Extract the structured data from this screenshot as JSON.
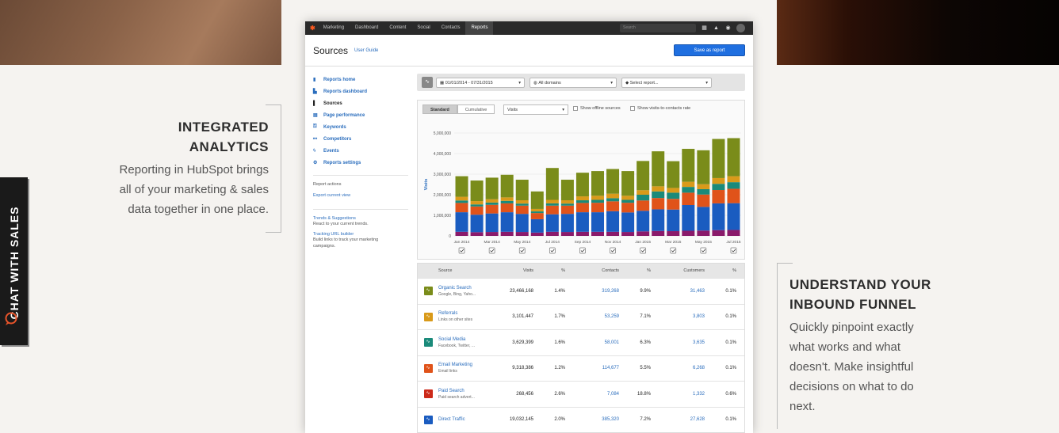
{
  "chat": {
    "label": "CHAT WITH SALES"
  },
  "feature_left": {
    "title_line1": "INTEGRATED",
    "title_line2": "ANALYTICS",
    "body_line1": "Reporting in HubSpot brings",
    "body_line2": "all of your marketing & sales",
    "body_line3": "data together in one place."
  },
  "feature_right": {
    "title_line1": "UNDERSTAND YOUR",
    "title_line2": "INBOUND FUNNEL",
    "body_line1": "Quickly pinpoint exactly",
    "body_line2": "what works and what",
    "body_line3": "doesn't. Make insightful",
    "body_line4": "decisions on what to do",
    "body_line5": "next."
  },
  "app": {
    "nav": {
      "brand": "Marketing",
      "items": [
        "Dashboard",
        "Content",
        "Social",
        "Contacts",
        "Reports"
      ],
      "active": "Reports",
      "search_placeholder": "Search"
    },
    "page_title": "Sources",
    "user_guide": "User Guide",
    "save_button": "Save as report",
    "sidebar": {
      "items": [
        {
          "label": "Reports home",
          "icon": "bar-chart-icon"
        },
        {
          "label": "Reports dashboard",
          "icon": "dashboard-icon"
        },
        {
          "label": "Sources",
          "icon": "bars-icon"
        },
        {
          "label": "Page performance",
          "icon": "page-icon"
        },
        {
          "label": "Keywords",
          "icon": "key-icon"
        },
        {
          "label": "Competitors",
          "icon": "competitors-icon"
        },
        {
          "label": "Events",
          "icon": "bolt-icon"
        },
        {
          "label": "Reports settings",
          "icon": "gear-icon"
        }
      ],
      "actions_title": "Report actions",
      "export_link": "Export current view",
      "trends_link": "Trends & Suggestions",
      "trends_desc": "React to your current trends.",
      "tracking_link": "Tracking URL builder",
      "tracking_desc_1": "Build links to track your marketing",
      "tracking_desc_2": "campaigns."
    },
    "filters": {
      "date_range": "01/01/2014 - 07/31/2015",
      "domains": "All domains",
      "report": "Select report..."
    },
    "chart_controls": {
      "tab_standard": "Standard",
      "tab_cumulative": "Cumulative",
      "metric": "Visits",
      "offline_label": "Show offline sources",
      "rate_label": "Show visits-to-contacts rate"
    }
  },
  "chart_data": {
    "type": "bar",
    "stacked": true,
    "ylabel": "Visits",
    "ylim": [
      0,
      5000000
    ],
    "yticks": [
      "0",
      "1,000,000",
      "2,000,000",
      "3,000,000",
      "4,000,000",
      "5,000,000"
    ],
    "categories": [
      "Jan 2014",
      "Feb 2014",
      "Mar 2014",
      "Apr 2014",
      "May 2014",
      "Jun 2014",
      "Jul 2014",
      "Aug 2014",
      "Sep 2014",
      "Oct 2014",
      "Nov 2014",
      "Dec 2014",
      "Jan 2015",
      "Feb 2015",
      "Mar 2015",
      "Apr 2015",
      "May 2015",
      "Jun 2015",
      "Jul 2015"
    ],
    "xtick_labels": [
      "Jan 2014",
      "Mar 2014",
      "May 2014",
      "Jul 2014",
      "Sep 2014",
      "Nov 2014",
      "Jan 2015",
      "Mar 2015",
      "May 2015",
      "Jul 2015"
    ],
    "series": [
      {
        "color": "#8a1a6b",
        "values": [
          200000,
          180000,
          190000,
          200000,
          190000,
          160000,
          200000,
          190000,
          200000,
          200000,
          200000,
          190000,
          220000,
          240000,
          230000,
          250000,
          260000,
          280000,
          290000
        ]
      },
      {
        "color": "#1a5cc0",
        "values": [
          950000,
          850000,
          900000,
          950000,
          880000,
          650000,
          850000,
          880000,
          950000,
          950000,
          1000000,
          950000,
          1000000,
          1050000,
          1050000,
          1250000,
          1150000,
          1300000,
          1300000
        ]
      },
      {
        "color": "#e0531a",
        "values": [
          450000,
          400000,
          420000,
          430000,
          400000,
          300000,
          420000,
          400000,
          450000,
          460000,
          480000,
          470000,
          500000,
          550000,
          520000,
          600000,
          600000,
          650000,
          700000
        ]
      },
      {
        "color": "#1a8a7a",
        "values": [
          120000,
          100000,
          110000,
          120000,
          100000,
          80000,
          110000,
          100000,
          130000,
          140000,
          150000,
          140000,
          280000,
          320000,
          300000,
          280000,
          260000,
          300000,
          320000
        ]
      },
      {
        "color": "#d99a1a",
        "values": [
          180000,
          160000,
          160000,
          170000,
          160000,
          120000,
          170000,
          160000,
          190000,
          200000,
          220000,
          200000,
          220000,
          250000,
          230000,
          250000,
          240000,
          280000,
          290000
        ]
      },
      {
        "color": "#7a8c1a",
        "values": [
          1000000,
          1000000,
          1050000,
          1100000,
          1000000,
          850000,
          1550000,
          1000000,
          1150000,
          1200000,
          1200000,
          1200000,
          1420000,
          1700000,
          1300000,
          1600000,
          1650000,
          1900000,
          1850000
        ]
      }
    ]
  },
  "table": {
    "headers": {
      "source": "Source",
      "visits": "Visits",
      "pct1": "%",
      "contacts": "Contacts",
      "pct2": "%",
      "customers": "Customers",
      "pct3": "%"
    },
    "rows": [
      {
        "name": "Organic Search",
        "sub": "Google, Bing, Yaho...",
        "color": "#7a8c1a",
        "visits": "23,466,168",
        "pct1": "1.4%",
        "contacts": "319,268",
        "pct2": "9.9%",
        "customers": "31,463",
        "pct3": "0.1%"
      },
      {
        "name": "Referrals",
        "sub": "Links on other sites",
        "color": "#d99a1a",
        "visits": "3,101,447",
        "pct1": "1.7%",
        "contacts": "53,259",
        "pct2": "7.1%",
        "customers": "3,803",
        "pct3": "0.1%"
      },
      {
        "name": "Social Media",
        "sub": "Facebook, Twitter, ...",
        "color": "#1a8a7a",
        "visits": "3,629,399",
        "pct1": "1.6%",
        "contacts": "58,001",
        "pct2": "6.3%",
        "customers": "3,635",
        "pct3": "0.1%"
      },
      {
        "name": "Email Marketing",
        "sub": "Email links",
        "color": "#e0531a",
        "visits": "9,318,386",
        "pct1": "1.2%",
        "contacts": "114,677",
        "pct2": "5.5%",
        "customers": "6,268",
        "pct3": "0.1%"
      },
      {
        "name": "Paid Search",
        "sub": "Paid search advert...",
        "color": "#cc2a1a",
        "visits": "268,456",
        "pct1": "2.6%",
        "contacts": "7,084",
        "pct2": "18.8%",
        "customers": "1,332",
        "pct3": "0.6%"
      },
      {
        "name": "Direct Traffic",
        "sub": "",
        "color": "#1a5cc0",
        "visits": "19,032,145",
        "pct1": "2.0%",
        "contacts": "385,320",
        "pct2": "7.2%",
        "customers": "27,628",
        "pct3": "0.1%"
      }
    ]
  }
}
